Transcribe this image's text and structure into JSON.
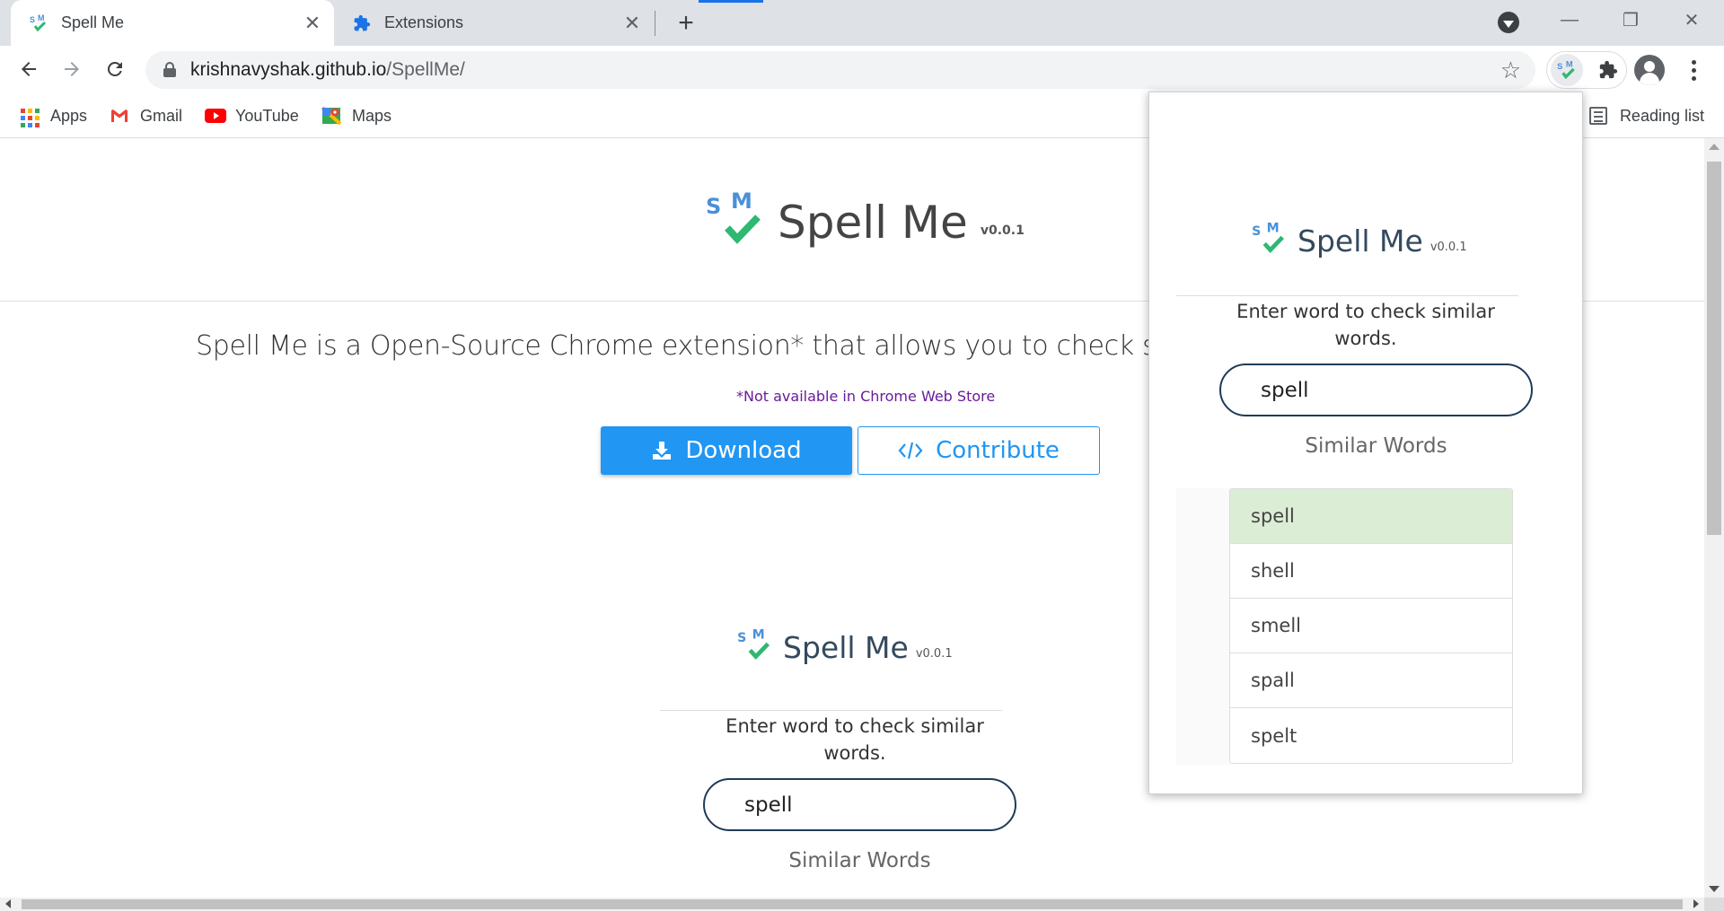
{
  "browser": {
    "tabs": [
      {
        "title": "Spell Me",
        "active": true
      },
      {
        "title": "Extensions",
        "active": false
      }
    ],
    "new_tab_symbol": "+",
    "close_symbol": "✕",
    "window": {
      "minimize": "—",
      "maximize": "❐",
      "close": "✕"
    },
    "url": {
      "host": "krishnavyshak.github.io",
      "path": "/SpellMe/"
    },
    "bookmarks": [
      {
        "label": "Apps",
        "icon": "apps-grid-icon"
      },
      {
        "label": "Gmail",
        "icon": "gmail-icon"
      },
      {
        "label": "YouTube",
        "icon": "youtube-icon"
      },
      {
        "label": "Maps",
        "icon": "maps-icon"
      }
    ],
    "reading_list": "Reading list"
  },
  "page": {
    "app_name": "Spell Me",
    "version": "v0.0.1",
    "tagline": "Spell Me is a Open-Source Chrome extension* that allows you to check spellings and",
    "note": "*Not available in Chrome Web Store",
    "download_label": "Download",
    "contribute_label": "Contribute",
    "demo": {
      "app_name": "Spell Me",
      "version": "v0.0.1",
      "prompt": "Enter word to check similar words.",
      "input_value": "spell",
      "similar_heading": "Similar Words"
    }
  },
  "popup": {
    "app_name": "Spell Me",
    "version": "v0.0.1",
    "prompt": "Enter word to check similar words.",
    "input_value": "spell",
    "similar_heading": "Similar Words",
    "results": [
      "spell",
      "shell",
      "smell",
      "spall",
      "spelt"
    ],
    "selected_index": 0
  },
  "colors": {
    "brand_blue": "#2196f3",
    "logo_s_m": "#4a90d9",
    "logo_check": "#2eb872",
    "selected_row": "#dcedd6",
    "input_border": "#1f3b57"
  }
}
